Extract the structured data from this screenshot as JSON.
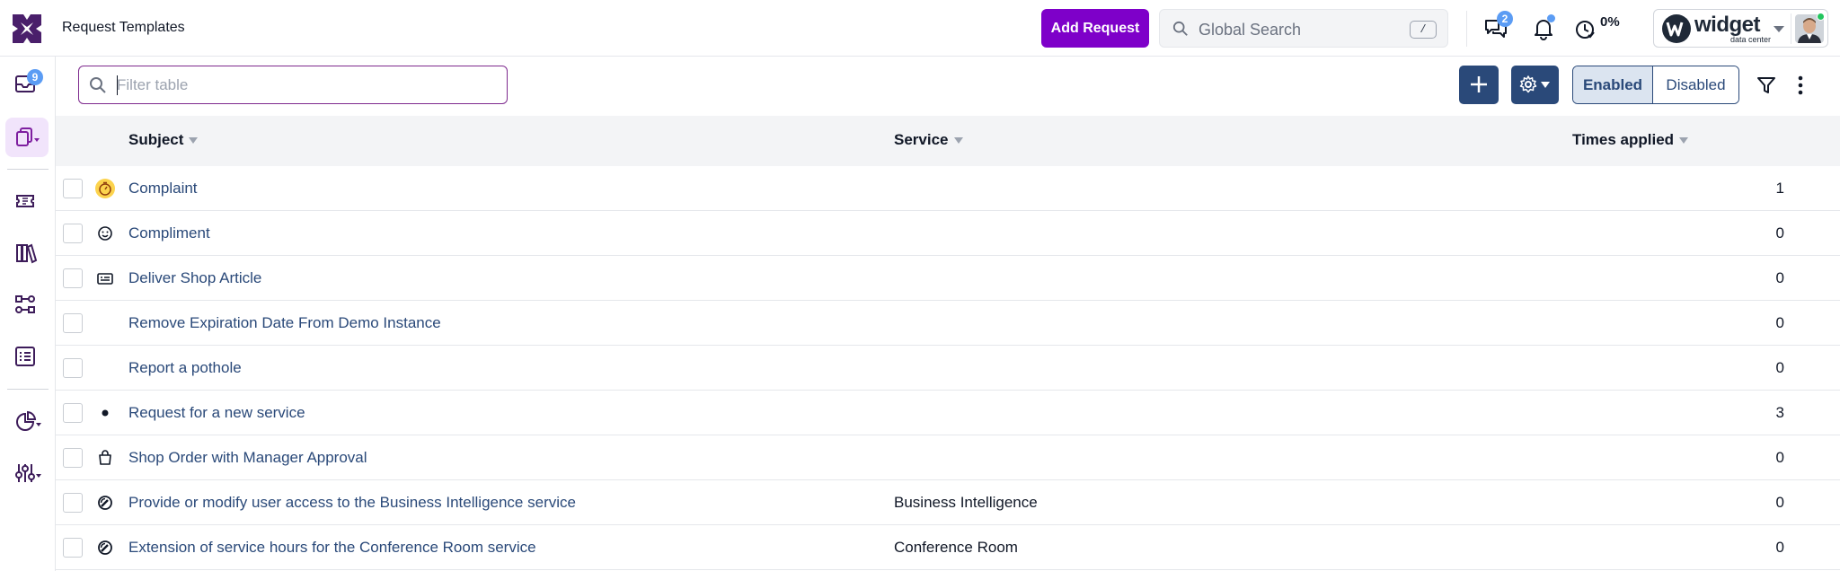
{
  "header": {
    "title": "Request Templates",
    "add_request_label": "Add Request",
    "search_placeholder": "Global Search",
    "search_shortcut": "/",
    "chat_badge": "2",
    "progress_text": "0%",
    "org_wordmark": "widget",
    "org_subtitle": "data center"
  },
  "sidebar": {
    "inbox_badge": "9"
  },
  "toolbar": {
    "filter_placeholder": "Filter table",
    "enabled_label": "Enabled",
    "disabled_label": "Disabled"
  },
  "table": {
    "columns": [
      "Subject",
      "Service",
      "Times applied"
    ],
    "rows": [
      {
        "icon": "stopwatch-icon",
        "subject": "Complaint",
        "service": "",
        "times": "1"
      },
      {
        "icon": "smiley-icon",
        "subject": "Compliment",
        "service": "",
        "times": "0"
      },
      {
        "icon": "id-card-icon",
        "subject": "Deliver Shop Article",
        "service": "",
        "times": "0"
      },
      {
        "icon": "",
        "subject": "Remove Expiration Date From Demo Instance",
        "service": "",
        "times": "0"
      },
      {
        "icon": "",
        "subject": "Report a pothole",
        "service": "",
        "times": "0"
      },
      {
        "icon": "dot-icon",
        "subject": "Request for a new service",
        "service": "",
        "times": "3"
      },
      {
        "icon": "shopping-bag-icon",
        "subject": "Shop Order with Manager Approval",
        "service": "",
        "times": "0"
      },
      {
        "icon": "gauge-icon",
        "subject": "Provide or modify user access to the Business Intelligence service",
        "service": "Business Intelligence",
        "times": "0"
      },
      {
        "icon": "gauge-icon",
        "subject": "Extension of service hours for the Conference Room service",
        "service": "Conference Room",
        "times": "0"
      }
    ]
  },
  "colors": {
    "brand_purple": "#7e00c9",
    "navy": "#2a4979",
    "link": "#2a4979",
    "badge_blue": "#5b9cf4"
  }
}
